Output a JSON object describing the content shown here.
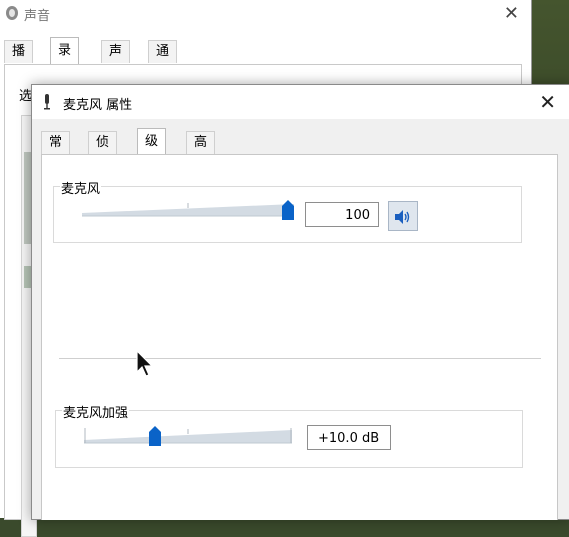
{
  "back_window": {
    "title": "声音",
    "tabs": [
      {
        "label": "播放"
      },
      {
        "label": "录制"
      },
      {
        "label": "声音"
      },
      {
        "label": "通信"
      }
    ],
    "active_tab": "录制",
    "panel_hint": "选"
  },
  "dialog": {
    "title": "麦克风 属性",
    "tabs": [
      {
        "label": "常规"
      },
      {
        "label": "侦听"
      },
      {
        "label": "级别"
      },
      {
        "label": "高级"
      }
    ],
    "active_tab": "级别",
    "microphone": {
      "label": "麦克风",
      "level_value": "100",
      "level_fraction": 1.0
    },
    "boost": {
      "label": "麦克风加强",
      "value": "+10.0 dB",
      "level_fraction": 0.33
    }
  },
  "colors": {
    "accent": "#0a63c8",
    "track": "#cfd7e0"
  },
  "icons": {
    "dialog_icon": "microphone-icon",
    "mute_button": "speaker-icon",
    "window_icon": "sound-icon"
  }
}
